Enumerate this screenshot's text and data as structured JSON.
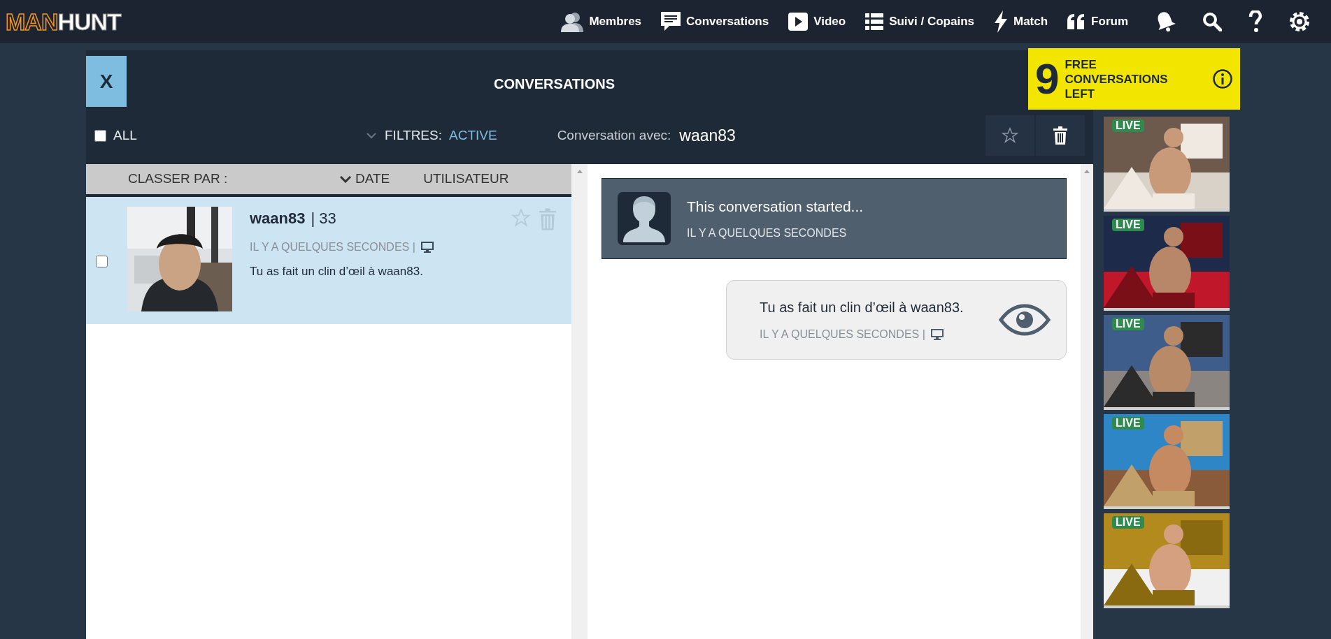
{
  "nav": {
    "logo": {
      "first": "MAN",
      "second": "HUNT"
    },
    "items": [
      {
        "label": "Membres"
      },
      {
        "label": "Conversations"
      },
      {
        "label": "Video"
      },
      {
        "label": "Suivi / Copains"
      },
      {
        "label": "Match"
      },
      {
        "label": "Forum"
      }
    ]
  },
  "header": {
    "close": "X",
    "title": "CONVERSATIONS"
  },
  "promo": {
    "count": "9",
    "text": "FREE CONVERSATIONS LEFT"
  },
  "filters": {
    "all_label": "ALL",
    "all_checked": false,
    "filter_label": "FILTRES:",
    "filter_value": "ACTIVE",
    "with_label": "Conversation avec:",
    "with_user": "waan83"
  },
  "sort": {
    "label": "CLASSER PAR :",
    "options": [
      {
        "label": "DATE",
        "selected": true
      },
      {
        "label": "UTILISATEUR",
        "selected": false
      }
    ]
  },
  "conversations": [
    {
      "username": "waan83",
      "age": "| 33",
      "time": "IL Y A QUELQUES SECONDES |",
      "message": "Tu as fait un clin d’œil à waan83.",
      "checked": false,
      "selected": true,
      "starred": false
    }
  ],
  "chat": {
    "system": {
      "title": "This conversation started...",
      "time": "IL Y A QUELQUES SECONDES"
    },
    "messages": [
      {
        "text": "Tu as fait un clin d’œil à waan83.",
        "time": "IL Y A QUELQUES SECONDES |"
      }
    ]
  },
  "live": [
    {
      "badge": "LIVE"
    },
    {
      "badge": "LIVE"
    },
    {
      "badge": "LIVE"
    },
    {
      "badge": "LIVE"
    },
    {
      "badge": "LIVE"
    }
  ]
}
